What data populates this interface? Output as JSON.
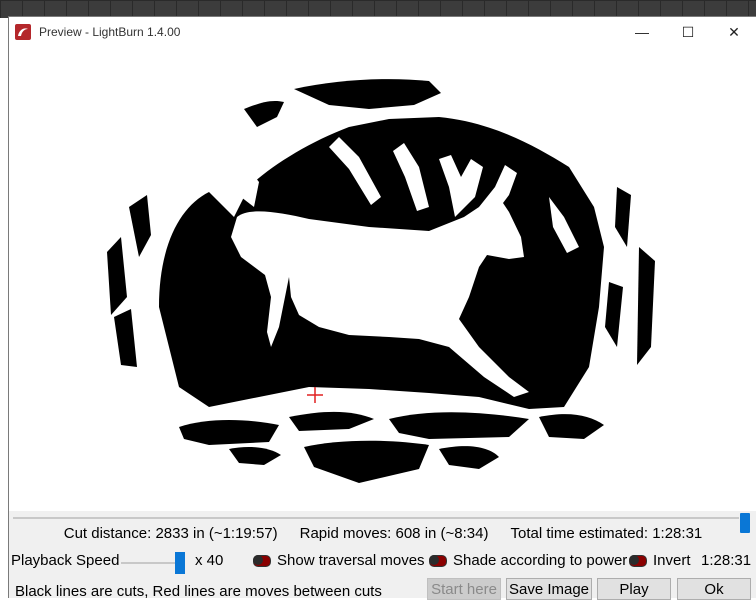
{
  "window": {
    "title": "Preview - LightBurn 1.4.00",
    "controls": {
      "minimize": "—",
      "maximize": "☐",
      "close": "✕"
    }
  },
  "preview": {
    "start_marker_color": "#e02020",
    "cut_color": "#000000",
    "progress": 1.0
  },
  "stats": {
    "cut_distance": "Cut distance: 2833 in (~1:19:57)",
    "rapid_moves": "Rapid moves: 608 in (~8:34)",
    "total_time": "Total time estimated: 1:28:31"
  },
  "controls": {
    "playback_speed_label": "Playback Speed",
    "speed_multiplier": "x 40",
    "show_traversal_label": "Show traversal moves",
    "shade_power_label": "Shade according to power",
    "invert_label": "Invert",
    "elapsed_time": "1:28:31"
  },
  "footer": {
    "hint": "Black lines are cuts, Red lines are moves between cuts",
    "start_here": "Start here",
    "save_image": "Save Image",
    "play": "Play",
    "ok": "Ok"
  },
  "colors": {
    "accent": "#0a77d6",
    "toggle_on": "#8a0000"
  }
}
